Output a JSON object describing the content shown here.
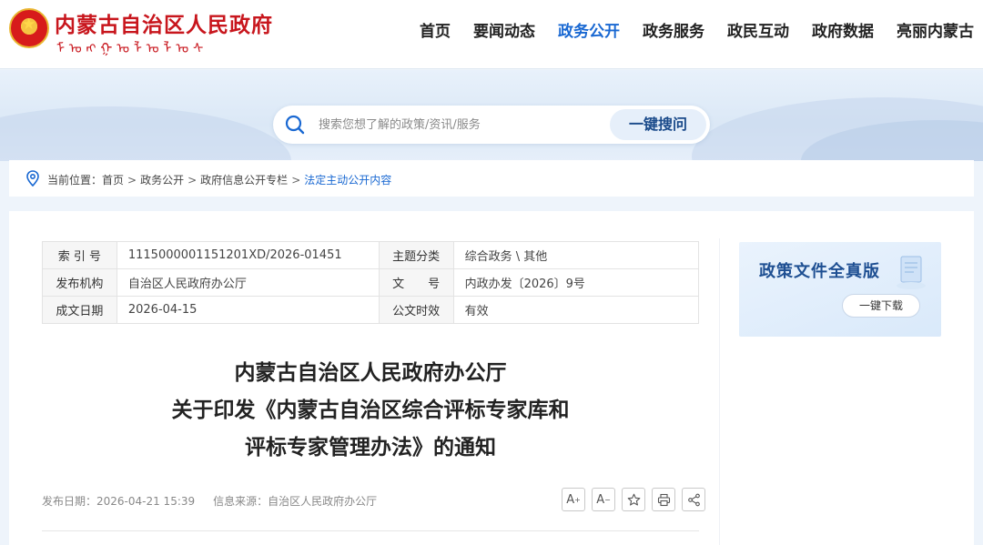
{
  "header": {
    "site_name": "内蒙古自治区人民政府",
    "site_name_mongolian": "ᠮᠣᠩᠭᠣᠯ ᠤᠯᠤᠰ",
    "nav": [
      {
        "label": "首页"
      },
      {
        "label": "要闻动态"
      },
      {
        "label": "政务公开",
        "active": true
      },
      {
        "label": "政务服务"
      },
      {
        "label": "政民互动"
      },
      {
        "label": "政府数据"
      },
      {
        "label": "亮丽内蒙古"
      }
    ]
  },
  "search": {
    "placeholder": "搜索您想了解的政策/资讯/服务",
    "button_label": "一键搜问"
  },
  "breadcrumb": {
    "prefix": "当前位置：",
    "items": [
      "首页",
      "政务公开",
      "政府信息公开专栏",
      "法定主动公开内容"
    ],
    "separator": ">"
  },
  "meta": {
    "rows": [
      {
        "k1": "索 引 号",
        "v1": "1115000001151201XD/2026-01451",
        "k2": "主题分类",
        "v2": "综合政务 \\ 其他"
      },
      {
        "k1": "发布机构",
        "v1": "自治区人民政府办公厅",
        "k2": "文　　号",
        "v2": "内政办发〔2026〕9号"
      },
      {
        "k1": "成文日期",
        "v1": "2026-04-15",
        "k2": "公文时效",
        "v2": "有效"
      }
    ]
  },
  "document": {
    "title_lines": [
      "内蒙古自治区人民政府办公厅",
      "关于印发《内蒙古自治区综合评标专家库和",
      "评标专家管理办法》的通知"
    ],
    "publish_date": "发布日期：2026-04-21 15:39",
    "source": "信息来源：自治区人民政府办公厅"
  },
  "tools": [
    {
      "icon": "font-increase-icon",
      "label": "A",
      "sup": "+"
    },
    {
      "icon": "font-decrease-icon",
      "label": "A",
      "sup": "−"
    },
    {
      "icon": "star-icon"
    },
    {
      "icon": "print-icon"
    },
    {
      "icon": "share-icon"
    }
  ],
  "promo": {
    "title": "政策文件全真版",
    "button_label": "一键下载"
  },
  "colors": {
    "brand_red": "#c8161d",
    "accent_blue": "#1968d2",
    "page_bg": "#eef4fb"
  }
}
